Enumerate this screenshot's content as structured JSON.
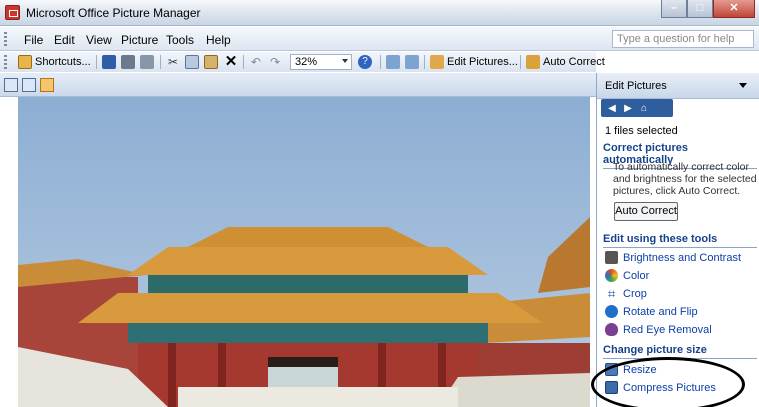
{
  "window": {
    "title": "Microsoft Office Picture Manager"
  },
  "menu": {
    "items": [
      {
        "label": "File",
        "hotkey": "F"
      },
      {
        "label": "Edit",
        "hotkey": "E"
      },
      {
        "label": "View",
        "hotkey": "V"
      },
      {
        "label": "Picture",
        "hotkey": "P"
      },
      {
        "label": "Tools",
        "hotkey": "T"
      },
      {
        "label": "Help",
        "hotkey": "H"
      }
    ],
    "help_placeholder": "Type a question for help"
  },
  "toolbar": {
    "shortcuts_label": "Shortcuts...",
    "zoom_value": "32%",
    "edit_pictures_label": "Edit Pictures...",
    "auto_correct_label": "Auto Correct"
  },
  "pane": {
    "title": "Edit Pictures",
    "files_selected": "1 files selected",
    "correct_heading": "Correct pictures automatically",
    "correct_description": "To automatically correct color and brightness for the selected pictures, click Auto Correct.",
    "auto_correct_button": "Auto Correct",
    "tools_heading": "Edit using these tools",
    "tools": [
      {
        "label": "Brightness and Contrast",
        "icon": "brightness-icon",
        "color": "#555555"
      },
      {
        "label": "Color",
        "icon": "color-wheel-icon",
        "color": "#e0501e"
      },
      {
        "label": "Crop",
        "icon": "crop-icon",
        "color": "#222222"
      },
      {
        "label": "Rotate and Flip",
        "icon": "rotate-icon",
        "color": "#1f6fc9"
      },
      {
        "label": "Red Eye Removal",
        "icon": "red-eye-icon",
        "color": "#7a3f8e"
      }
    ],
    "size_heading": "Change picture size",
    "size_tools": [
      {
        "label": "Resize",
        "icon": "resize-icon",
        "color": "#4a78b8"
      },
      {
        "label": "Compress Pictures",
        "icon": "compress-icon",
        "color": "#3d6aa8"
      }
    ]
  },
  "colors": {
    "pane_accent": "#15428b",
    "link": "#0b3fa8",
    "app_icon": "#c8362f"
  }
}
